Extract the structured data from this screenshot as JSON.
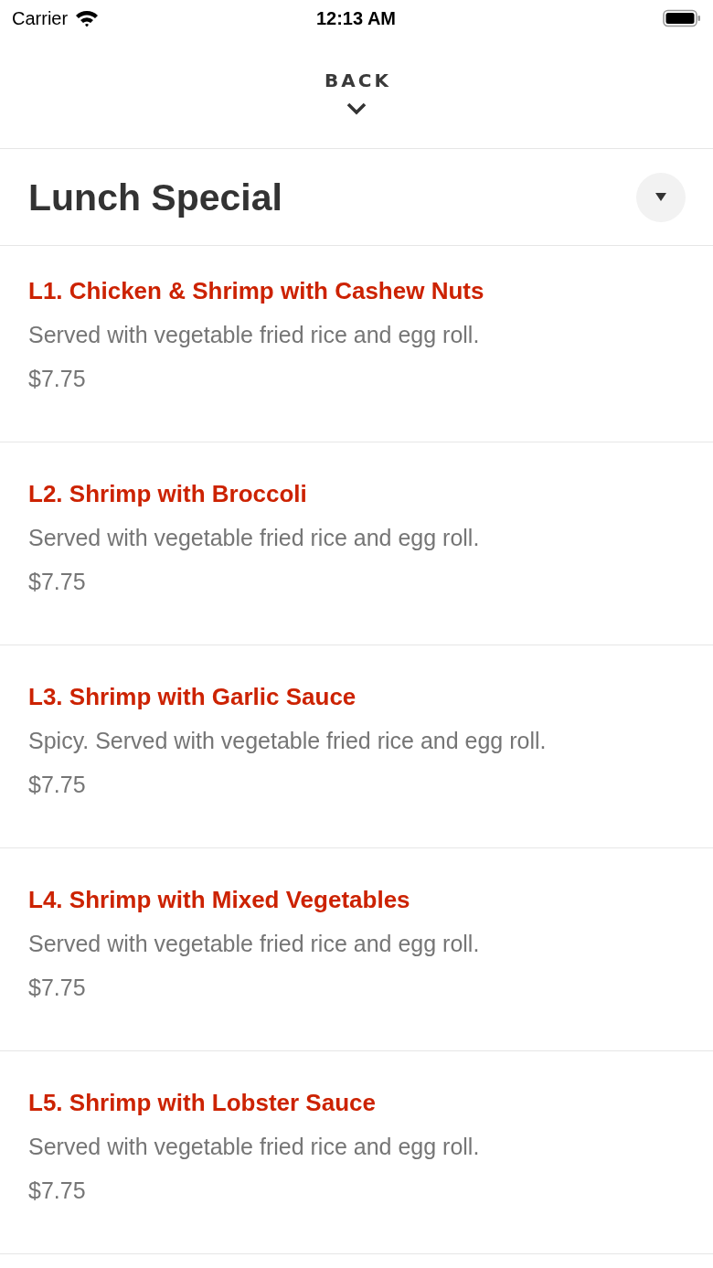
{
  "status_bar": {
    "carrier": "Carrier",
    "time": "12:13 AM"
  },
  "header": {
    "back_label": "BACK"
  },
  "section": {
    "title": "Lunch Special"
  },
  "items": [
    {
      "name": "L1. Chicken & Shrimp with Cashew Nuts",
      "description": "Served with vegetable fried rice and egg roll.",
      "price": "$7.75"
    },
    {
      "name": "L2. Shrimp with Broccoli",
      "description": "Served with vegetable fried rice and egg roll.",
      "price": "$7.75"
    },
    {
      "name": "L3. Shrimp with Garlic Sauce",
      "description": "Spicy. Served with vegetable fried rice and egg roll.",
      "price": "$7.75"
    },
    {
      "name": "L4. Shrimp with Mixed Vegetables",
      "description": "Served with vegetable fried rice and egg roll.",
      "price": "$7.75"
    },
    {
      "name": "L5. Shrimp with Lobster Sauce",
      "description": "Served with vegetable fried rice and egg roll.",
      "price": "$7.75"
    }
  ]
}
